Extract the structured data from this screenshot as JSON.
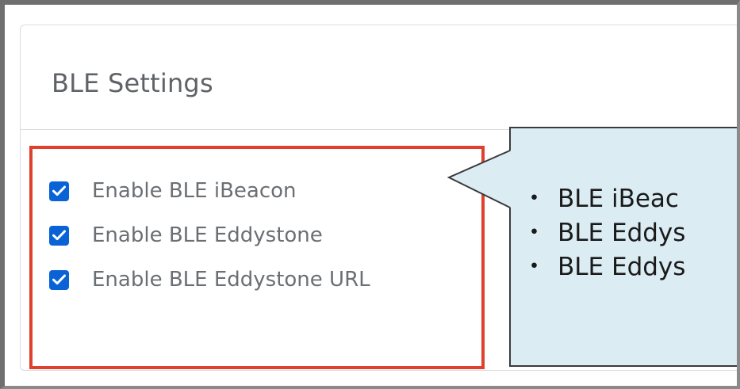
{
  "panel": {
    "title": "BLE Settings",
    "options": [
      {
        "label": "Enable BLE iBeacon",
        "checked": true
      },
      {
        "label": "Enable BLE Eddystone",
        "checked": true
      },
      {
        "label": "Enable BLE Eddystone URL",
        "checked": true
      }
    ]
  },
  "callout": {
    "bullet": "・",
    "items": [
      "BLE iBeac",
      "BLE Eddys",
      "BLE Eddys"
    ]
  },
  "colors": {
    "checkbox": "#0a63d6",
    "highlight": "#e0412e",
    "callout_bg": "#dbecf3"
  }
}
